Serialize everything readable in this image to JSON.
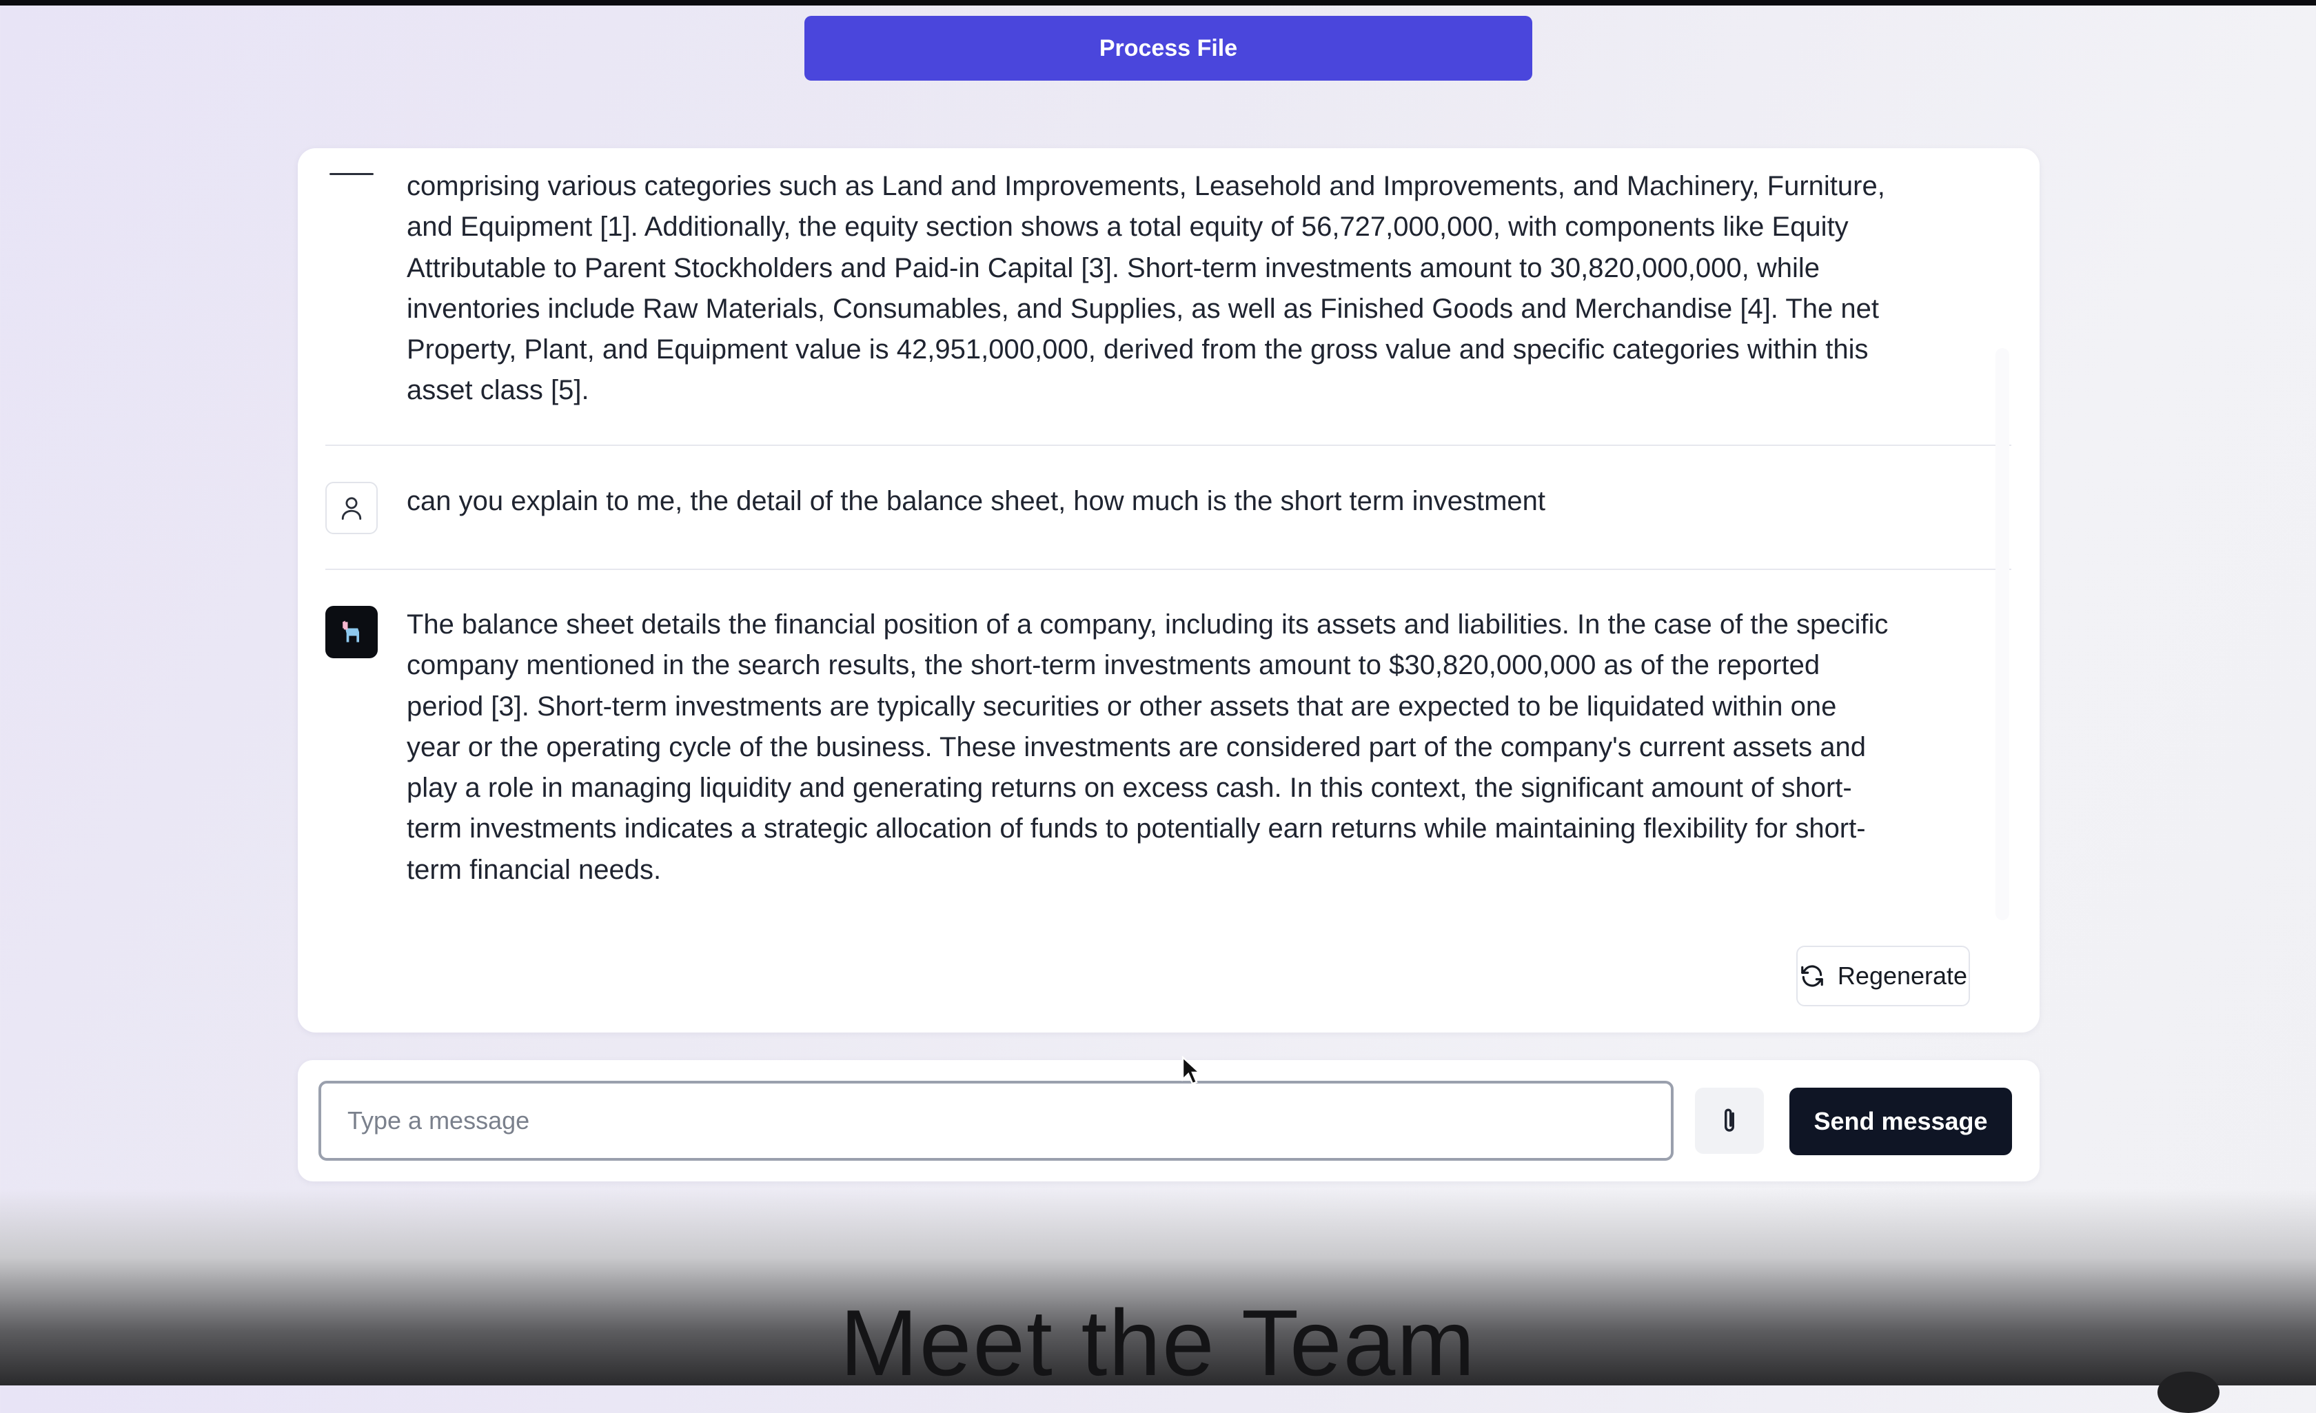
{
  "toolbar": {
    "process_label": "Process File"
  },
  "chat": {
    "messages": [
      {
        "role": "assistant",
        "text": "comprising various categories such as Land and Improvements, Leasehold and Improvements, and Machinery, Furniture, and Equipment [1]. Additionally, the equity section shows a total equity of 56,727,000,000, with components like Equity Attributable to Parent Stockholders and Paid-in Capital [3]. Short-term investments amount to 30,820,000,000, while inventories include Raw Materials, Consumables, and Supplies, as well as Finished Goods and Merchandise [4]. The net Property, Plant, and Equipment value is 42,951,000,000, derived from the gross value and specific categories within this asset class [5]."
      },
      {
        "role": "user",
        "text": "can you explain to me, the detail of the balance sheet, how much is the short term investment"
      },
      {
        "role": "assistant",
        "text": "The balance sheet details the financial position of a company, including its assets and liabilities. In the case of the specific company mentioned in the search results, the short-term investments amount to $30,820,000,000 as of the reported period [3]. Short-term investments are typically securities or other assets that are expected to be liquidated within one year or the operating cycle of the business. These investments are considered part of the company's current assets and play a role in managing liquidity and generating returns on excess cash. In this context, the significant amount of short-term investments indicates a strategic allocation of funds to potentially earn returns while maintaining flexibility for short-term financial needs."
      }
    ],
    "regenerate_label": "Regenerate"
  },
  "composer": {
    "placeholder": "Type a message",
    "value": "",
    "attach_icon": "paperclip-icon",
    "send_label": "Send message"
  },
  "section": {
    "title": "Meet the Team"
  },
  "colors": {
    "accent": "#4a46dc",
    "send_button": "#0f1525",
    "text": "#1f2430"
  }
}
